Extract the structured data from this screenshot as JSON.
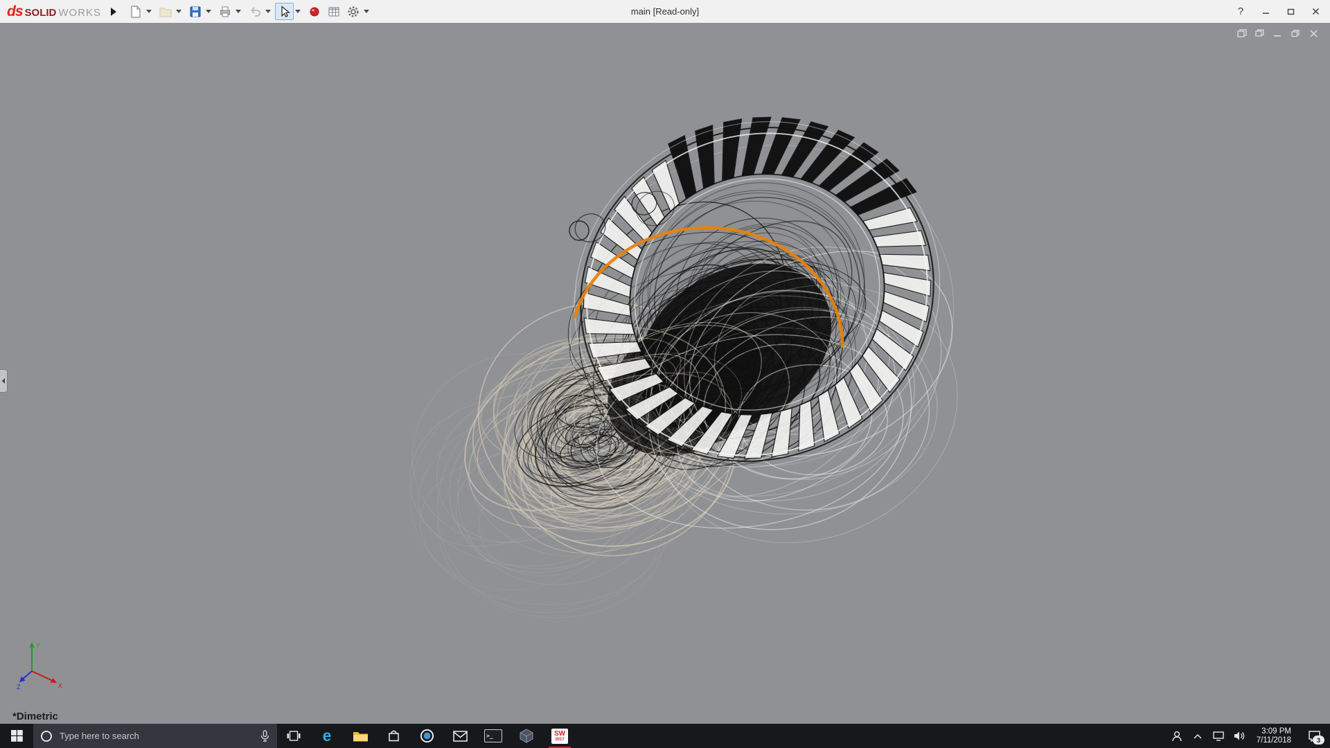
{
  "titlebar": {
    "brand_mark": "ds",
    "brand_solid": "SOLID",
    "brand_works": "WORKS",
    "document_title": "main [Read-only]",
    "help_label": "?",
    "toolbar_icons": [
      "new-document",
      "open-document",
      "save",
      "print",
      "undo",
      "select-cursor",
      "appearance",
      "design-table",
      "options"
    ]
  },
  "viewport": {
    "view_orientation_label": "*Dimetric",
    "triad_axes": [
      "Y",
      "X",
      "Z"
    ]
  },
  "taskbar": {
    "search_placeholder": "Type here to search",
    "edge_letter": "e",
    "cmd_glyph": ">_",
    "solidworks_label": "SW",
    "solidworks_year": "2017",
    "time": "3:09 PM",
    "date": "7/11/2018",
    "notification_badge": "3"
  },
  "colors": {
    "viewport_bg": "#8f9194",
    "accent_orange": "#e8820c",
    "wire_tan": "#cdc3b1",
    "wire_black": "#101010",
    "wire_white": "#f4f4f2"
  }
}
